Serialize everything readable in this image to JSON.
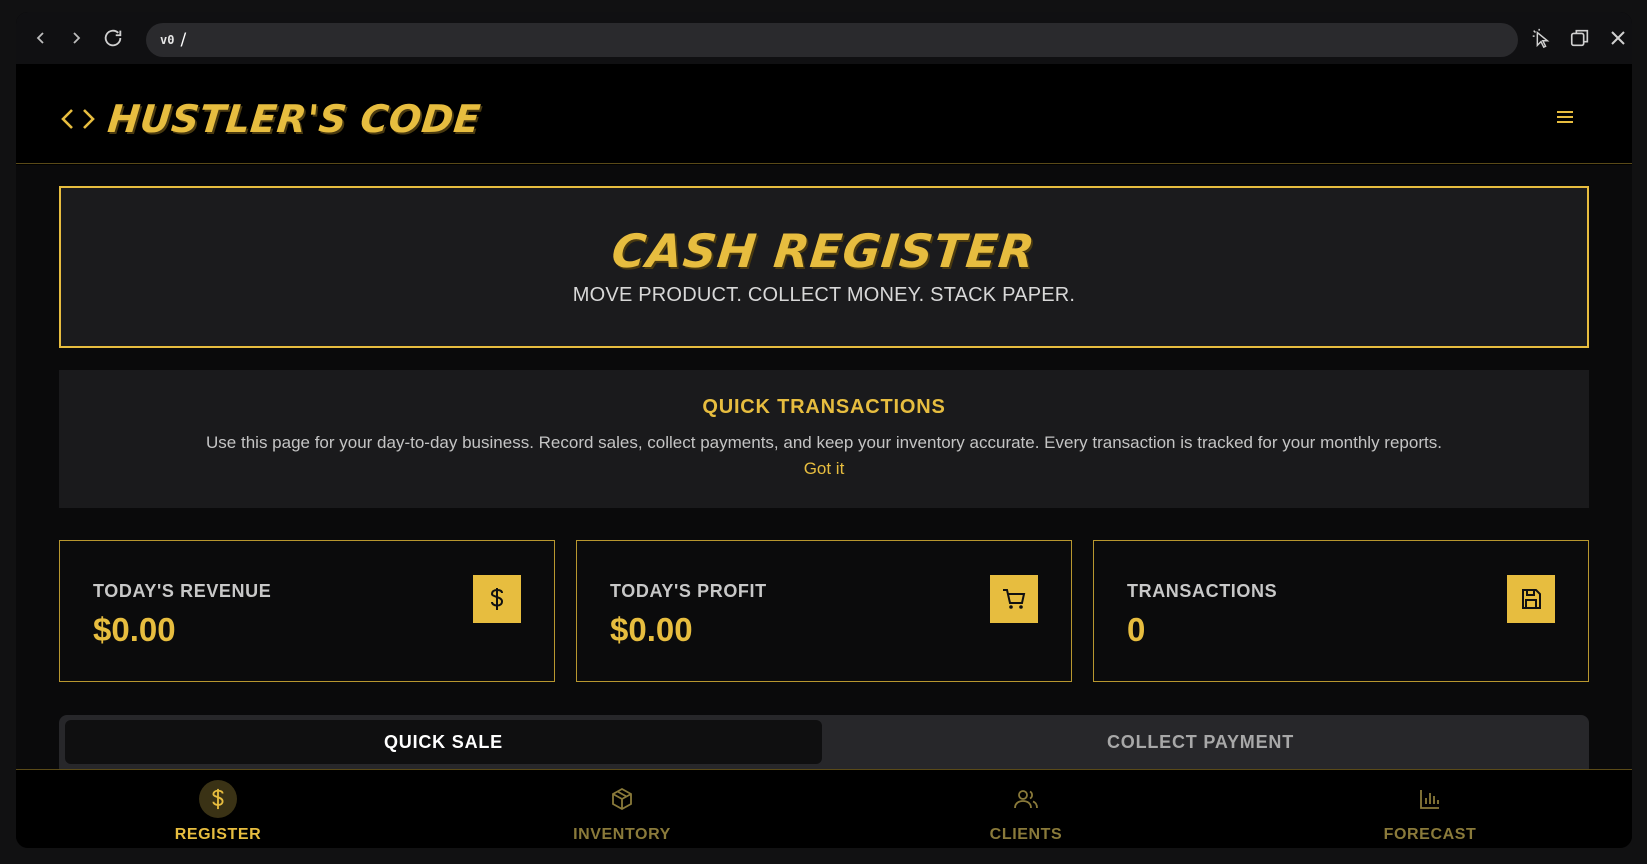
{
  "browser": {
    "url_prefix": "v0",
    "url_path": "/"
  },
  "header": {
    "brand_icon": "code-brackets-icon",
    "brand_title": "HUSTLER'S CODE",
    "menu_icon": "hamburger-menu-icon"
  },
  "hero": {
    "title": "CASH REGISTER",
    "subtitle": "MOVE PRODUCT. COLLECT MONEY. STACK PAPER."
  },
  "info": {
    "title": "QUICK TRANSACTIONS",
    "text": "Use this page for your day-to-day business. Record sales, collect payments, and keep your inventory accurate. Every transaction is tracked for your monthly reports.",
    "link": "Got it"
  },
  "stats": [
    {
      "label": "TODAY'S REVENUE",
      "value": "$0.00",
      "icon": "dollar-icon"
    },
    {
      "label": "TODAY'S PROFIT",
      "value": "$0.00",
      "icon": "shopping-cart-icon"
    },
    {
      "label": "TRANSACTIONS",
      "value": "0",
      "icon": "save-floppy-icon"
    }
  ],
  "tabs": [
    {
      "label": "QUICK SALE",
      "active": true
    },
    {
      "label": "COLLECT PAYMENT",
      "active": false
    }
  ],
  "bottom_nav": [
    {
      "label": "REGISTER",
      "icon": "dollar-icon",
      "active": true
    },
    {
      "label": "INVENTORY",
      "icon": "box-icon",
      "active": false
    },
    {
      "label": "CLIENTS",
      "icon": "users-icon",
      "active": false
    },
    {
      "label": "FORECAST",
      "icon": "bar-chart-icon",
      "active": false
    }
  ],
  "colors": {
    "accent": "#e7bd3f",
    "background": "#000000",
    "panel": "#1b1b1d"
  }
}
